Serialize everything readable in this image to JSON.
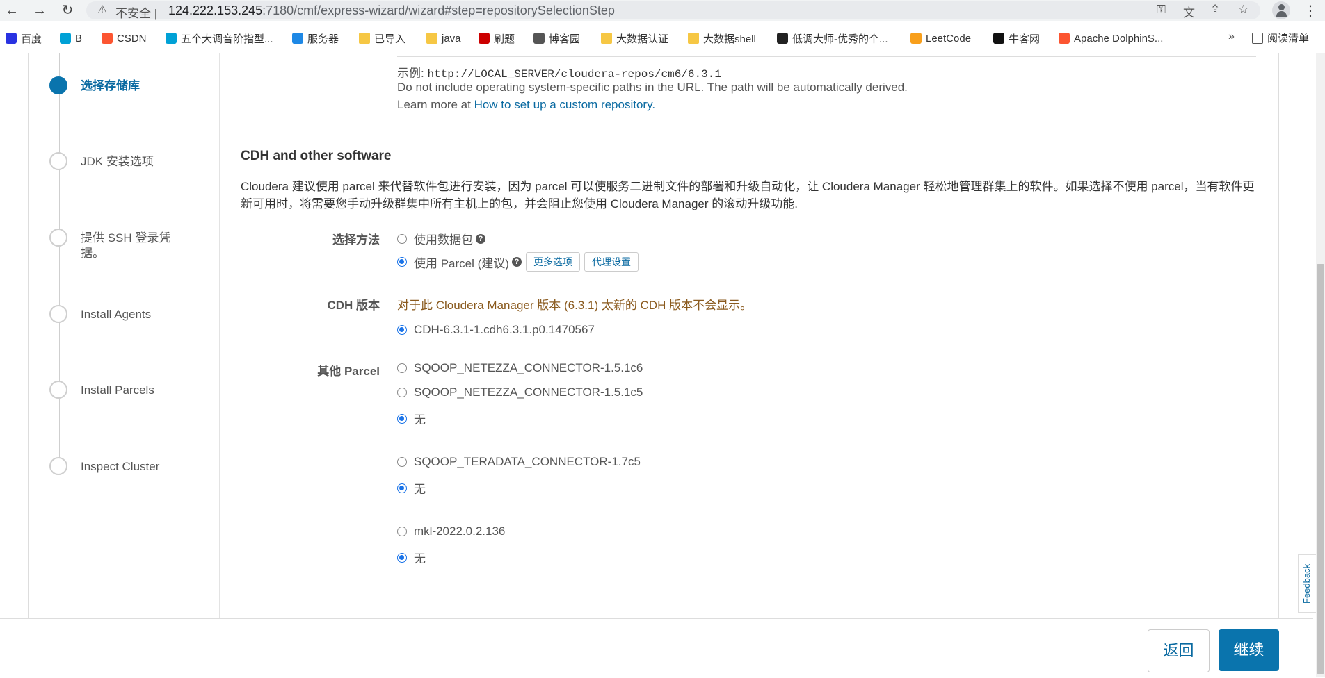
{
  "browser": {
    "insecure_label": "不安全 |",
    "url_host": "124.222.153.245",
    "url_rest": ":7180/cmf/express-wizard/wizard#step=repositorySelectionStep"
  },
  "bookmarks": [
    {
      "label": "百度",
      "icon": "baidu-icon",
      "color": "#2932e1"
    },
    {
      "label": "B",
      "icon": "bilibili-icon",
      "color": "#00a1d6"
    },
    {
      "label": "CSDN",
      "icon": "csdn-icon",
      "color": "#fc5531"
    },
    {
      "label": "五个大调音阶指型...",
      "icon": "bilibili-icon",
      "color": "#00a1d6"
    },
    {
      "label": "服务器",
      "icon": "cloud-icon",
      "color": "#1e88e5"
    },
    {
      "label": "已导入",
      "icon": "folder-icon",
      "color": "#f6c744"
    },
    {
      "label": "java",
      "icon": "folder-icon",
      "color": "#f6c744"
    },
    {
      "label": "刷题",
      "icon": "redhat-icon",
      "color": "#cc0000"
    },
    {
      "label": "博客园",
      "icon": "cnblogs-icon",
      "color": "#555555"
    },
    {
      "label": "大数据认证",
      "icon": "folder-icon",
      "color": "#f6c744"
    },
    {
      "label": "大数据shell",
      "icon": "folder-icon",
      "color": "#f6c744"
    },
    {
      "label": "低调大师-优秀的个...",
      "icon": "logo-icon",
      "color": "#222222"
    },
    {
      "label": "LeetCode",
      "icon": "leetcode-icon",
      "color": "#f89f1b"
    },
    {
      "label": "牛客网",
      "icon": "nowcoder-icon",
      "color": "#111111"
    },
    {
      "label": "Apache DolphinS...",
      "icon": "csdn-icon",
      "color": "#fc5531"
    }
  ],
  "bookmarks_more": "»",
  "reading_list": "阅读清单",
  "steps": [
    {
      "label": "选择存储库",
      "active": true
    },
    {
      "label": "JDK 安装选项",
      "active": false
    },
    {
      "label": "提供 SSH 登录凭据。",
      "active": false
    },
    {
      "label": "Install Agents",
      "active": false
    },
    {
      "label": "Install Parcels",
      "active": false
    },
    {
      "label": "Inspect Cluster",
      "active": false
    }
  ],
  "repo_hint": {
    "example_prefix": "示例:",
    "example_url": "http://LOCAL_SERVER/cloudera-repos/cm6/6.3.1",
    "note": "Do not include operating system-specific paths in the URL. The path will be automatically derived.",
    "learn_prefix": "Learn more at",
    "learn_link": "How to set up a custom repository."
  },
  "cdh": {
    "title": "CDH and other software",
    "description": "Cloudera 建议使用 parcel 来代替软件包进行安装，因为 parcel 可以使服务二进制文件的部署和升级自动化，让 Cloudera Manager 轻松地管理群集上的软件。如果选择不使用 parcel，当有软件更新可用时，将需要您手动升级群集中所有主机上的包，并会阻止您使用 Cloudera Manager 的滚动升级功能.",
    "method_label": "选择方法",
    "method_packages": "使用数据包",
    "method_parcel": "使用 Parcel (建议)",
    "more_options": "更多选项",
    "proxy_settings": "代理设置",
    "version_label": "CDH 版本",
    "version_warning": "对于此 Cloudera Manager 版本 (6.3.1) 太新的 CDH 版本不会显示。",
    "version_option": "CDH-6.3.1-1.cdh6.3.1.p0.1470567",
    "other_label": "其他 Parcel",
    "groups": [
      {
        "options": [
          {
            "label": "SQOOP_NETEZZA_CONNECTOR-1.5.1c6",
            "checked": false
          },
          {
            "label": "SQOOP_NETEZZA_CONNECTOR-1.5.1c5",
            "checked": false
          },
          {
            "label": "无",
            "checked": true
          }
        ]
      },
      {
        "options": [
          {
            "label": "SQOOP_TERADATA_CONNECTOR-1.7c5",
            "checked": false
          },
          {
            "label": "无",
            "checked": true
          }
        ]
      },
      {
        "options": [
          {
            "label": "mkl-2022.0.2.136",
            "checked": false
          },
          {
            "label": "无",
            "checked": true
          }
        ]
      }
    ]
  },
  "footer": {
    "back": "返回",
    "continue": "继续"
  },
  "feedback": "Feedback"
}
